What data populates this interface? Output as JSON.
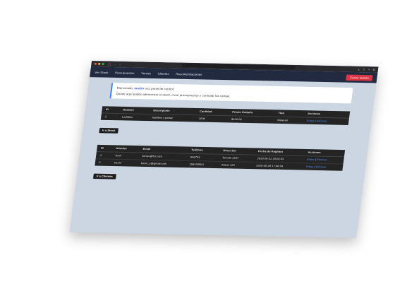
{
  "colors": {
    "accent": "#dc3545",
    "nav": "#212a3f",
    "page_bg": "#ccd6e3",
    "link": "#4f8df6"
  },
  "browser": {
    "dots": [
      "#ff5f57",
      "#febc2e",
      "#28c840"
    ],
    "icons": [
      "sidebar-icon",
      "back-icon",
      "forward-icon",
      "shield-icon",
      "reload-icon",
      "download-icon",
      "share-icon",
      "new-tab-icon",
      "tabs-icon"
    ]
  },
  "nav": {
    "items": [
      "Ver Stock",
      "Presupuestos",
      "Ventas",
      "Clientes",
      "Recomendaciones"
    ],
    "logout": "Cerrar Sesión"
  },
  "welcome": {
    "greeting_pre": "Bienvenido, ",
    "user": "martin",
    "greeting_post": " a tu panel de control.",
    "message": "Desde aquí podés administrar el stock, crear presupuestos y controlar las ventas."
  },
  "stock": {
    "headers": [
      "ID",
      "Nombre",
      "Descripción",
      "Cantidad",
      "Precio Unitario",
      "Tipo",
      "Acciones"
    ],
    "rows": [
      {
        "id": "2",
        "nombre": "Ladrillos",
        "descripcion": "ladrillos x pedac",
        "cantidad": "1000",
        "precio": "$100.00",
        "tipo": "Material",
        "editar": "Editar",
        "sep": "|",
        "eliminar": "Eliminar"
      }
    ],
    "button": "Ir a Stock"
  },
  "clientes": {
    "headers": [
      "ID",
      "Nombre",
      "Email",
      "Teléfono",
      "Dirección",
      "Fecha de Registro",
      "Acciones"
    ],
    "rows": [
      {
        "id": "4",
        "nombre": "Juan",
        "email": "correo@fcr.com",
        "telefono": "546753",
        "direccion": "Tercola 1547",
        "fecha": "2025-05-22 20:04:53",
        "editar": "Editar",
        "sep": "|",
        "eliminar": "Eliminar"
      },
      {
        "id": "5",
        "nombre": "Kevin",
        "email": "kevin_y@gmail.com",
        "telefono": "256430954",
        "direccion": "Alsina 123",
        "fecha": "2025-05-28 17:46:34",
        "editar": "Editar",
        "sep": "|",
        "eliminar": "Eliminar"
      }
    ],
    "button": "Ir a Clientes"
  }
}
